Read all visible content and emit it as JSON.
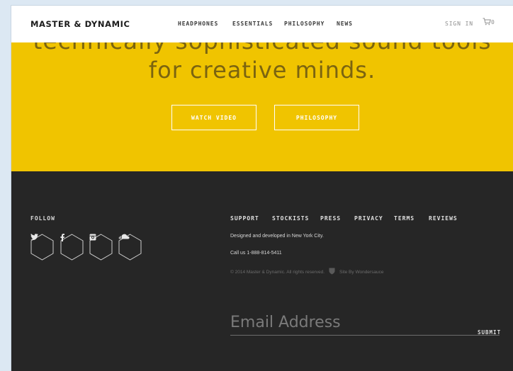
{
  "nav": {
    "logo": "MASTER & DYNAMIC",
    "links": [
      "HEADPHONES",
      "ESSENTIALS",
      "PHILOSOPHY",
      "NEWS"
    ],
    "sign_in": "SIGN IN",
    "cart_count": "0"
  },
  "hero": {
    "line1": "technically sophisticated sound tools",
    "line2": "for creative minds.",
    "watch_video": "WATCH VIDEO",
    "philosophy": "PHILOSOPHY",
    "color": "#f0c400"
  },
  "footer": {
    "follow": "FOLLOW",
    "social_icons": [
      "twitter-icon",
      "facebook-icon",
      "instagram-icon",
      "soundcloud-icon"
    ],
    "links": [
      "SUPPORT",
      "STOCKISTS",
      "PRESS",
      "PRIVACY",
      "TERMS",
      "REVIEWS"
    ],
    "designed": "Designed and developed in New York City.",
    "call": "Call us 1-888-814-5411",
    "copyright": "© 2014 Master & Dynamic. All rights reserved.",
    "site_by": "Site By Wondersauce",
    "email_placeholder": "Email Address",
    "submit": "SUBMIT",
    "color": "#262626"
  }
}
